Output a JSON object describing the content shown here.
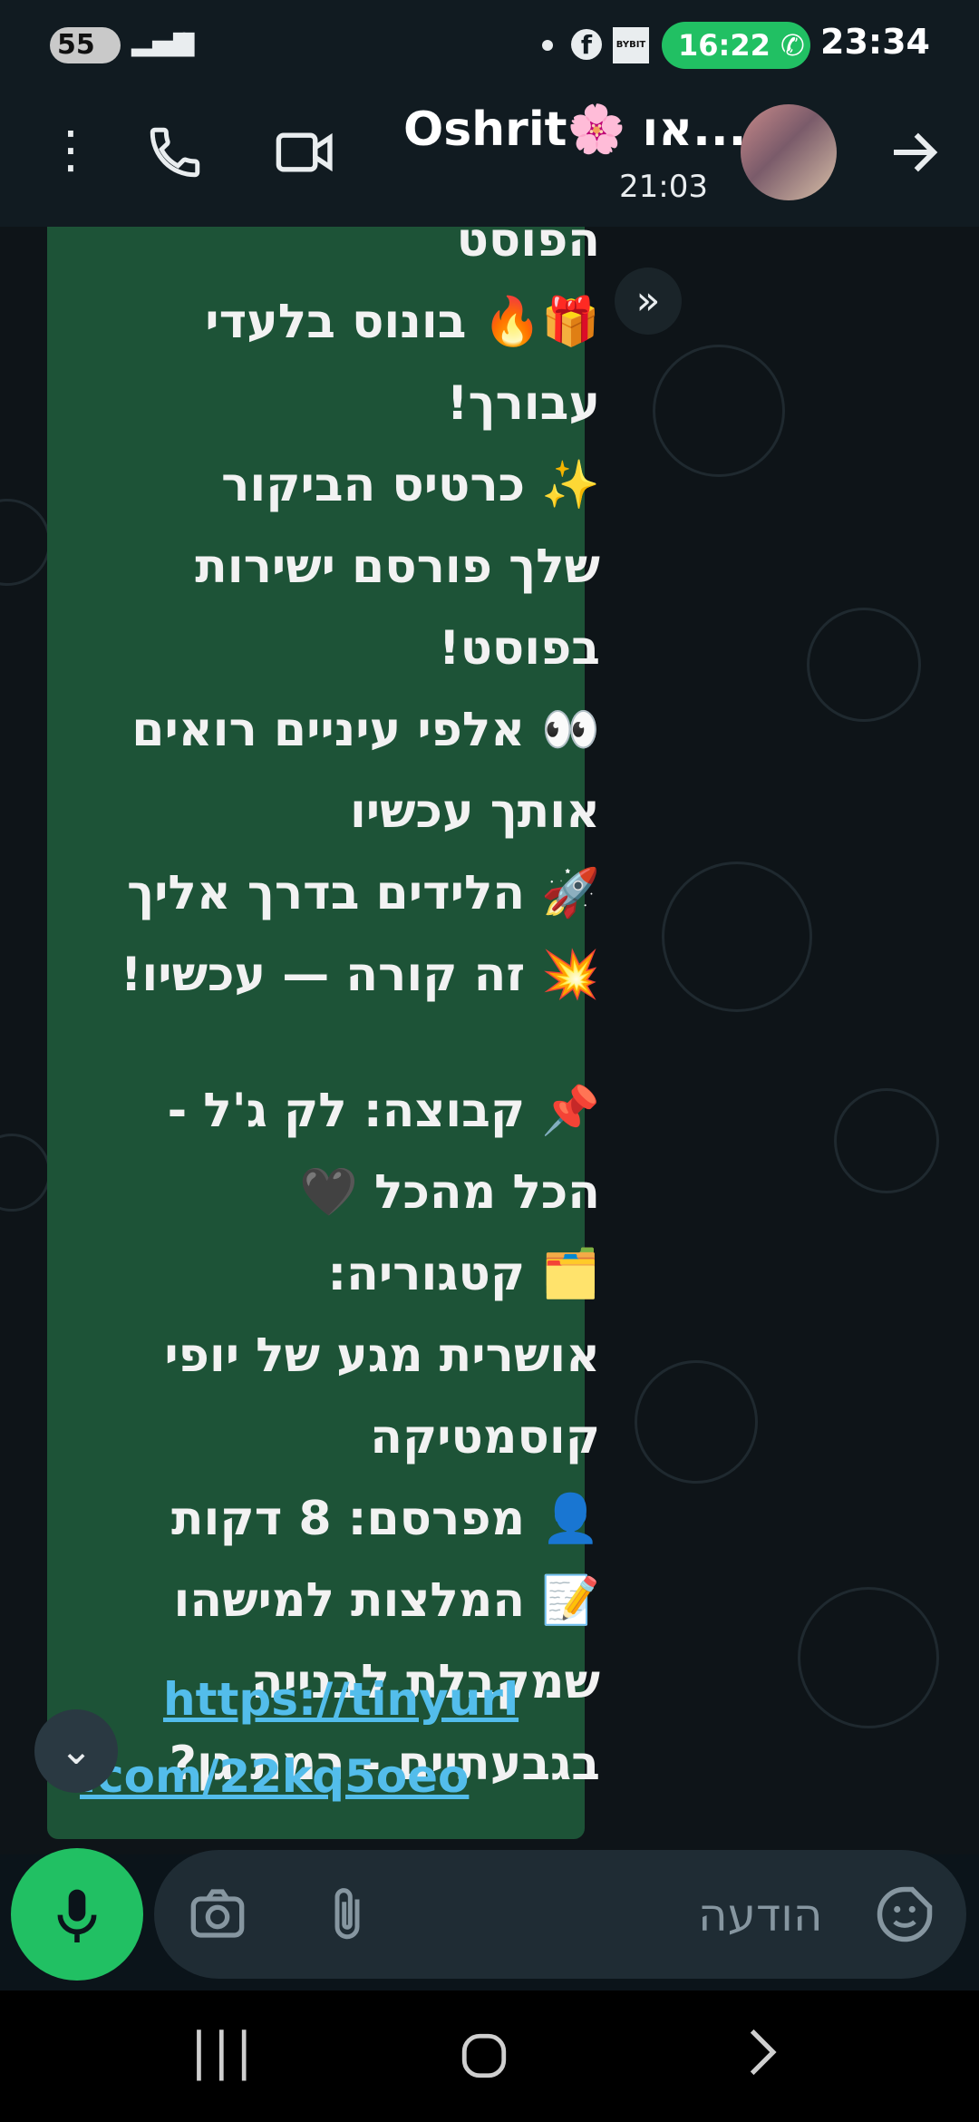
{
  "statusbar": {
    "battery": "55",
    "call_timer": "16:22",
    "clock": "23:34",
    "bybit_label": "BYBIT"
  },
  "header": {
    "contact_name": "Oshrit🌸 או...",
    "last_seen": "21:03",
    "icons": [
      "more-vert-icon",
      "phone-icon",
      "video-camera-icon",
      "avatar",
      "forward-arrow-icon"
    ]
  },
  "message": {
    "lines": [
      "הפוסט",
      "🎁🔥 בונוס בלעדי",
      "עבורך!",
      "✨ כרטיס הביקור",
      "שלך פורסם ישירות",
      "בפוסט!",
      "👀 אלפי עיניים רואים",
      "אותך עכשיו",
      "🚀 הלידים בדרך אליך",
      "💥 זה קורה — עכשיו!",
      "",
      "📌 קבוצה: לק ג'ל -",
      "הכל מהכל 🖤",
      "🗂️ קטגוריה:",
      "אושרית מגע של יופי",
      "קוסמטיקה",
      "👤 מפרסם: 8 דקות",
      "📝 המלצות למישהו",
      "שמקבלת לבנייה",
      "בגבעתיים - רמת גן?"
    ],
    "link_line1": "https://tinyurl",
    "link_line2": ".com/22kq5oeo"
  },
  "composer": {
    "placeholder": "הודעה"
  },
  "colors": {
    "bubble": "#1d5337",
    "accent": "#21c063",
    "link": "#53bdeb",
    "background": "#0b141a"
  }
}
